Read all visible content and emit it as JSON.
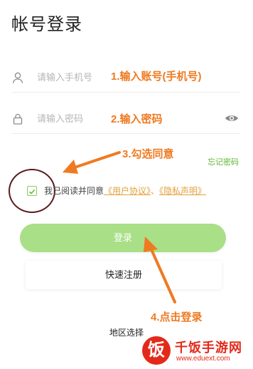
{
  "header": {
    "title": "帐号登录"
  },
  "account": {
    "placeholder": "请输入手机号",
    "annotation": "1.输入账号(手机号)"
  },
  "password": {
    "placeholder": "请输入密码",
    "annotation": "2.输入密码"
  },
  "annotations": {
    "check_agree": "3.勾选同意",
    "click_login": "4.点击登录"
  },
  "forgot_password": "忘记密码",
  "agreement": {
    "checked": true,
    "prefix": "我已阅读并同意",
    "user_agreement": "《用户协议》",
    "separator": "、",
    "privacy_policy": "《隐私声明》"
  },
  "login_button": "登录",
  "quick_register": "快速注册",
  "region_select": "地区选择",
  "watermark": {
    "logo_char": "饭",
    "name": "千饭手游网",
    "url": "www.eduext.com"
  },
  "colors": {
    "accent_green": "#a9df86",
    "annotation_orange": "#ef7a22",
    "link_orange": "#e3a03a",
    "forgot_green": "#5fb62f"
  },
  "icons": [
    "user-icon",
    "lock-icon",
    "eye-icon",
    "check-icon"
  ]
}
